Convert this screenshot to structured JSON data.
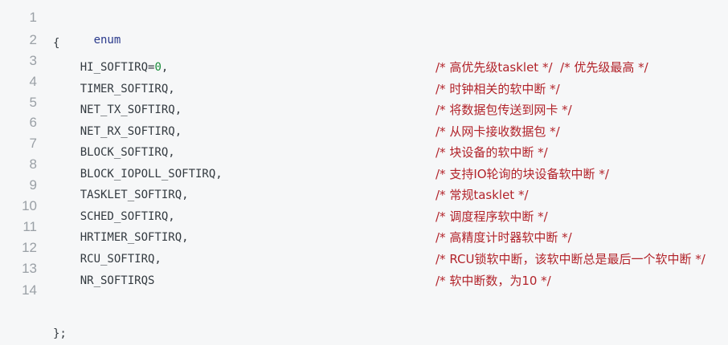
{
  "gutter": {
    "line_numbers": [
      "1",
      "2",
      "3",
      "4",
      "5",
      "6",
      "7",
      "8",
      "9",
      "10",
      "11",
      "12",
      "13",
      "14"
    ]
  },
  "code": {
    "lines": [
      {
        "kw": "enum"
      },
      {
        "text": "{"
      },
      {
        "name": "    HI_SOFTIRQ=",
        "num": "0",
        "tail": ",",
        "comment": "/* 高优先级tasklet */  /* 优先级最高 */"
      },
      {
        "text": "    TIMER_SOFTIRQ,",
        "comment": "/* 时钟相关的软中断 */"
      },
      {
        "text": "    NET_TX_SOFTIRQ,",
        "comment": "/* 将数据包传送到网卡 */"
      },
      {
        "text": "    NET_RX_SOFTIRQ,",
        "comment": "/* 从网卡接收数据包 */"
      },
      {
        "text": "    BLOCK_SOFTIRQ,",
        "comment": "/* 块设备的软中断 */"
      },
      {
        "text": "    BLOCK_IOPOLL_SOFTIRQ,",
        "comment": "/* 支持IO轮询的块设备软中断 */"
      },
      {
        "text": "    TASKLET_SOFTIRQ,",
        "comment": "/* 常规tasklet */"
      },
      {
        "text": "    SCHED_SOFTIRQ,",
        "comment": "/* 调度程序软中断 */"
      },
      {
        "text": "    HRTIMER_SOFTIRQ,",
        "comment": "/* 高精度计时器软中断 */"
      },
      {
        "text": "    RCU_SOFTIRQ,",
        "comment": "/* RCU锁软中断，该软中断总是最后一个软中断 */"
      },
      {
        "text": "    NR_SOFTIRQS",
        "comment": "/* 软中断数，为10 */"
      },
      {
        "text": "};"
      }
    ]
  }
}
